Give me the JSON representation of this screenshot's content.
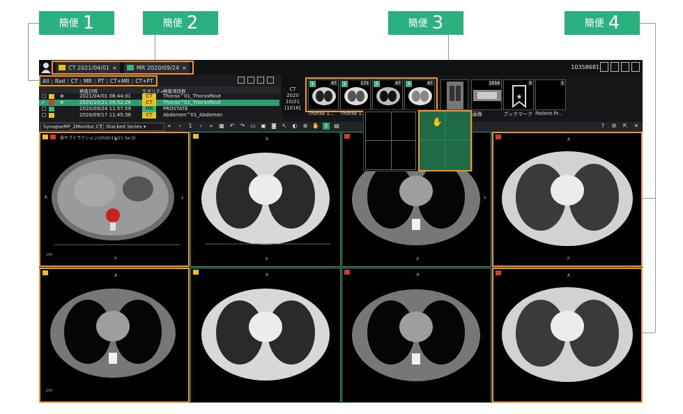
{
  "callouts": [
    {
      "text": "簡便",
      "num": "1"
    },
    {
      "text": "簡便",
      "num": "2"
    },
    {
      "text": "簡便",
      "num": "3"
    },
    {
      "text": "簡便",
      "num": "4"
    }
  ],
  "titlebar": {
    "tabs": [
      {
        "label": "CT 2021/04/01",
        "close": "×",
        "color": "#e8c020"
      },
      {
        "label": "MR 2020/09/24",
        "close": "×",
        "color": "#3ab47b"
      }
    ],
    "patient_id": "10358681"
  },
  "filters": [
    "All",
    "Rad",
    "CT",
    "MR",
    "PT",
    "CT+MR",
    "CT+PT"
  ],
  "study_list": {
    "headers": [
      "検査日時",
      "モダリティ",
      "検査項目群"
    ],
    "rows": [
      {
        "date": "2021/04/01 08:44:01",
        "modality": "CT",
        "desc": "Thorax^01_ThoraxRout",
        "dot": "#e8c020",
        "mod_color": "#e8c020"
      },
      {
        "date": "2020/10/21 09:52:26",
        "modality": "CT",
        "desc": "Thorax^01_ThoraxRout",
        "dot": "#d23b2a",
        "mod_color": "#e8c020"
      },
      {
        "date": "2020/09/24 11:57:59",
        "modality": "MR",
        "desc": "PROSTATE",
        "dot": "#3ab47b",
        "mod_color": "#3ab47b"
      },
      {
        "date": "2020/09/17 11:45:38",
        "modality": "CT",
        "desc": "Abdomen^01_Abdomen",
        "dot": "#e8c020",
        "mod_color": "#e8c020"
      }
    ]
  },
  "series_strip": {
    "exam_info": [
      "CT",
      "2020",
      "10/21",
      "[1016]"
    ],
    "thumbs": [
      {
        "num": "1",
        "count": "47",
        "caption": "Thorax 1..."
      },
      {
        "num": "2",
        "count": "171",
        "caption": "Thorax 1..."
      },
      {
        "num": "3",
        "count": "47",
        "caption": ""
      },
      {
        "num": "4",
        "count": "47",
        "caption": ""
      },
      {
        "num": "",
        "count": "",
        "caption": ""
      },
      {
        "num": "",
        "count": "1016",
        "caption": "画像"
      },
      {
        "num": "",
        "count": "0",
        "caption": "ブックマーク"
      },
      {
        "num": "",
        "count": "1",
        "caption": "Patient Pr..."
      }
    ]
  },
  "toolbar": {
    "monitor_select": "SynapseRP_2Monitor,CT",
    "series_select": "Stacked Series",
    "page": "1"
  },
  "viewports": [
    {
      "header": "骨サブトラクション(2020/10/21 Se:3)"
    },
    {
      "header": ""
    },
    {
      "header": ""
    },
    {
      "header": ""
    },
    {
      "header": ""
    },
    {
      "header": ""
    },
    {
      "header": ""
    },
    {
      "header": ""
    }
  ],
  "orientation": {
    "anterior": "A",
    "posterior": "P",
    "right": "R",
    "left": "L",
    "unit": "cm"
  }
}
